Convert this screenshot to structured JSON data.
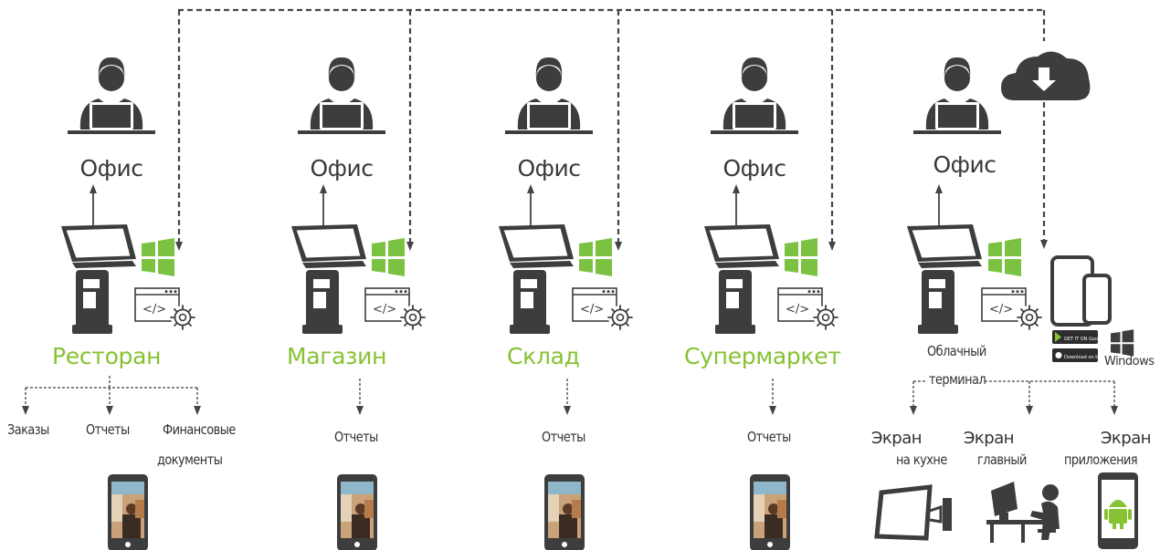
{
  "top_bus": {
    "style": "dashed",
    "color": "#444444"
  },
  "columns": [
    {
      "office_label": "Офис",
      "venue_label": "Ресторан",
      "reports": [
        "Заказы",
        "Отчеты",
        "Финансовые документы"
      ]
    },
    {
      "office_label": "Офис",
      "venue_label": "Магазин",
      "reports": [
        "Отчеты"
      ]
    },
    {
      "office_label": "Офис",
      "venue_label": "Склад",
      "reports": [
        "Отчеты"
      ]
    },
    {
      "office_label": "Офис",
      "venue_label": "Супермаркет",
      "reports": [
        "Отчеты"
      ]
    }
  ],
  "cloud_column": {
    "office_label": "Офис",
    "terminal_label": "Облачный терминал",
    "cloud_icon": "cloud-download-icon",
    "store_badges": [
      "GET IT ON Google Play",
      "Download on the App Store"
    ],
    "windows_label": "Windows",
    "screens": [
      {
        "line1": "Экран",
        "line2": "на кухне",
        "icon": "wall-monitor-icon"
      },
      {
        "line1": "Экран",
        "line2": "главный",
        "icon": "desk-computer-icon"
      },
      {
        "line1": "Экран",
        "line2": "приложения",
        "icon": "android-phone-icon"
      }
    ]
  },
  "colors": {
    "accent_green": "#86c232",
    "windows_green": "#7cc242",
    "icon_dark": "#3d3d3d"
  }
}
